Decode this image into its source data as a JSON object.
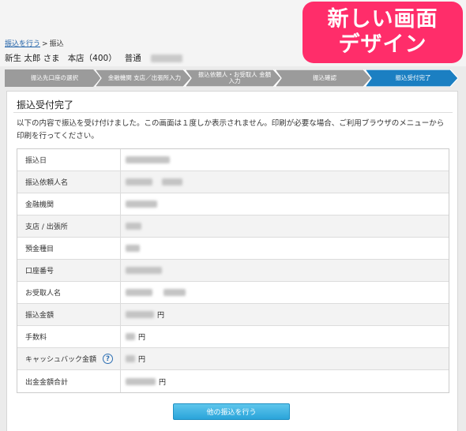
{
  "breadcrumb": {
    "link": "振込を行う",
    "separator": ">",
    "current": "振込"
  },
  "user": {
    "name": "新生 太郎 さま",
    "branch": "本店（400）",
    "account_type": "普通"
  },
  "badge": {
    "line1": "新しい画面",
    "line2": "デザイン"
  },
  "steps": [
    {
      "label": "振込先口座の選択",
      "state": "done"
    },
    {
      "label": "金融機関 支店／出張所入力",
      "state": "done"
    },
    {
      "label": "振込依頼人・お受取人 金額入力",
      "state": "done"
    },
    {
      "label": "振込確認",
      "state": "done"
    },
    {
      "label": "振込受付完了",
      "state": "current"
    }
  ],
  "panel": {
    "title": "振込受付完了",
    "message": "以下の内容で振込を受け付けました。この画面は１度しか表示されません。印刷が必要な場合、ご利用ブラウザのメニューから印刷を行ってください。"
  },
  "table": {
    "rows": [
      {
        "label": "振込日",
        "suffix": ""
      },
      {
        "label": "振込依頼人名",
        "suffix": ""
      },
      {
        "label": "金融機関",
        "suffix": ""
      },
      {
        "label": "支店 / 出張所",
        "suffix": ""
      },
      {
        "label": "預金種目",
        "suffix": ""
      },
      {
        "label": "口座番号",
        "suffix": ""
      },
      {
        "label": "お受取人名",
        "suffix": ""
      },
      {
        "label": "振込金額",
        "suffix": "円"
      },
      {
        "label": "手数料",
        "suffix": "円"
      },
      {
        "label": "キャッシュバック金額",
        "suffix": "円",
        "help": "?"
      },
      {
        "label": "出金金額合計",
        "suffix": "円"
      }
    ]
  },
  "button": {
    "label": "他の振込を行う"
  },
  "colors": {
    "step_done": "#9b9b9b",
    "step_current": "#1b7fc2",
    "button": "#2aa4da",
    "badge": "#ff2d6a"
  }
}
